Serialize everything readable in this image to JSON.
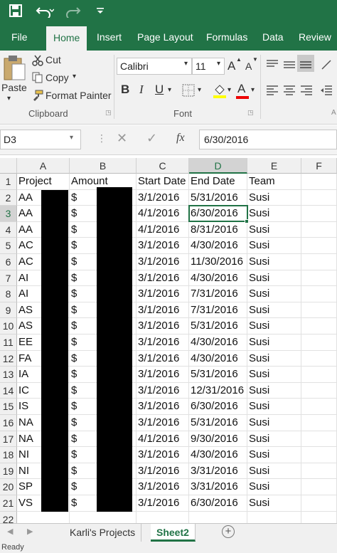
{
  "ribbon_tabs": [
    "File",
    "Home",
    "Insert",
    "Page Layout",
    "Formulas",
    "Data",
    "Review"
  ],
  "active_tab": "Home",
  "clipboard": {
    "paste": "Paste",
    "cut": "Cut",
    "copy": "Copy",
    "format_painter": "Format Painter",
    "group_label": "Clipboard"
  },
  "font": {
    "name": "Calibri",
    "size": "11",
    "group_label": "Font",
    "grow": "A",
    "shrink": "A",
    "bold": "B",
    "italic": "I",
    "underline": "U",
    "font_color_letter": "A"
  },
  "name_box": "D3",
  "formula_bar": {
    "fx": "fx",
    "value": "6/30/2016"
  },
  "columns": [
    "A",
    "B",
    "C",
    "D",
    "E",
    "F"
  ],
  "selected_column": "D",
  "selected_row": "3",
  "headers": [
    "Project",
    "Amount",
    "Start Date",
    "End Date",
    "Team"
  ],
  "rows": [
    {
      "num": "2",
      "a": "AA",
      "b": "$",
      "start": "3/1/2016",
      "end": "5/31/2016",
      "team": "Susi"
    },
    {
      "num": "3",
      "a": "AA",
      "b": "$",
      "start": "4/1/2016",
      "end": "6/30/2016",
      "team": "Susi"
    },
    {
      "num": "4",
      "a": "AA",
      "b": "$",
      "start": "4/1/2016",
      "end": "8/31/2016",
      "team": "Susi"
    },
    {
      "num": "5",
      "a": "AC",
      "b": "$",
      "start": "3/1/2016",
      "end": "4/30/2016",
      "team": "Susi"
    },
    {
      "num": "6",
      "a": "AC",
      "b": "$",
      "start": "3/1/2016",
      "end": "11/30/2016",
      "team": "Susi"
    },
    {
      "num": "7",
      "a": "AI",
      "b": "$",
      "start": "3/1/2016",
      "end": "4/30/2016",
      "team": "Susi"
    },
    {
      "num": "8",
      "a": "AI",
      "b": "$",
      "start": "3/1/2016",
      "end": "7/31/2016",
      "team": "Susi"
    },
    {
      "num": "9",
      "a": "AS",
      "b": "$",
      "start": "3/1/2016",
      "end": "7/31/2016",
      "team": "Susi"
    },
    {
      "num": "10",
      "a": "AS",
      "b": "$",
      "start": "3/1/2016",
      "end": "5/31/2016",
      "team": "Susi"
    },
    {
      "num": "11",
      "a": "EE",
      "b": "$",
      "start": "3/1/2016",
      "end": "4/30/2016",
      "team": "Susi"
    },
    {
      "num": "12",
      "a": "FA",
      "b": "$",
      "start": "3/1/2016",
      "end": "4/30/2016",
      "team": "Susi"
    },
    {
      "num": "13",
      "a": "IA",
      "b": "$",
      "start": "3/1/2016",
      "end": "5/31/2016",
      "team": "Susi"
    },
    {
      "num": "14",
      "a": "IC",
      "b": "$",
      "start": "3/1/2016",
      "end": "12/31/2016",
      "team": "Susi"
    },
    {
      "num": "15",
      "a": "IS",
      "b": "$",
      "start": "3/1/2016",
      "end": "6/30/2016",
      "team": "Susi"
    },
    {
      "num": "16",
      "a": "NA",
      "b": "$",
      "start": "3/1/2016",
      "end": "5/31/2016",
      "team": "Susi"
    },
    {
      "num": "17",
      "a": "NA",
      "b": "$",
      "start": "4/1/2016",
      "end": "9/30/2016",
      "team": "Susi"
    },
    {
      "num": "18",
      "a": "NI",
      "b": "$",
      "start": "3/1/2016",
      "end": "4/30/2016",
      "team": "Susi"
    },
    {
      "num": "19",
      "a": "NI",
      "b": "$",
      "start": "3/1/2016",
      "end": "3/31/2016",
      "team": "Susi"
    },
    {
      "num": "20",
      "a": "SP",
      "b": "$",
      "start": "3/1/2016",
      "end": "3/31/2016",
      "team": "Susi"
    },
    {
      "num": "21",
      "a": "VS",
      "b": "$",
      "start": "3/1/2016",
      "end": "6/30/2016",
      "team": "Susi"
    },
    {
      "num": "22",
      "a": "",
      "b": "",
      "start": "",
      "end": "",
      "team": ""
    }
  ],
  "header_row_num": "1",
  "sheets": [
    "Karli's Projects",
    "Sheet2"
  ],
  "active_sheet": "Sheet2",
  "add_sheet": "+",
  "status": "Ready",
  "colors": {
    "excel_green": "#217346",
    "ribbon_bg": "#f1f1f1"
  }
}
